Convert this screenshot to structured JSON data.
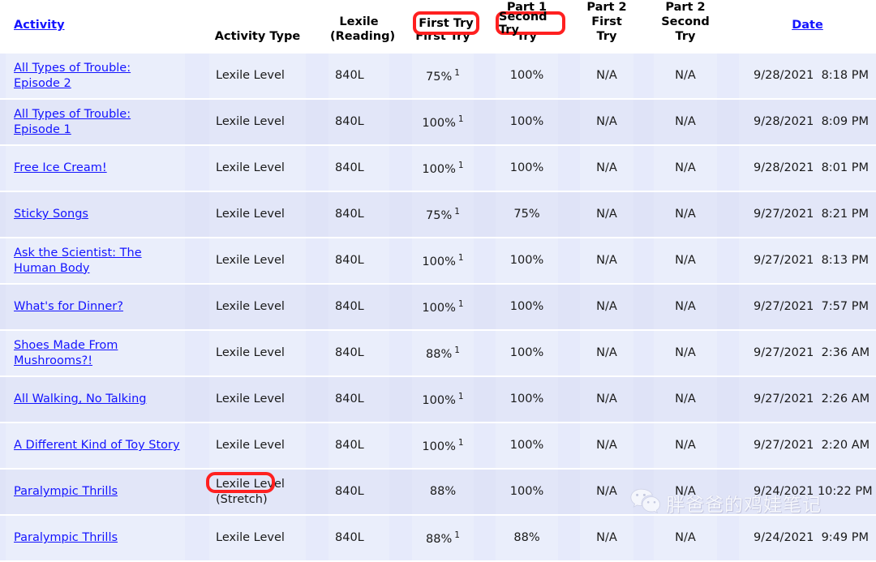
{
  "table": {
    "columns": [
      {
        "key": "activity",
        "label": "Activity",
        "link": true,
        "align": "left"
      },
      {
        "key": "type",
        "label": "Activity Type",
        "link": false,
        "align": "center"
      },
      {
        "key": "lexile",
        "label": "Lexile\n(Reading)",
        "link": false,
        "align": "center"
      },
      {
        "key": "p1first",
        "label": "Part 1\nFirst Try",
        "link": false,
        "align": "center"
      },
      {
        "key": "p1second",
        "label": "Part 1\nSecond Try",
        "link": false,
        "align": "center"
      },
      {
        "key": "p2first",
        "label": "Part 2\nFirst\nTry",
        "link": false,
        "align": "center"
      },
      {
        "key": "p2second",
        "label": "Part 2\nSecond\nTry",
        "link": false,
        "align": "center"
      },
      {
        "key": "date",
        "label": "Date",
        "link": true,
        "align": "center"
      }
    ],
    "headers": {
      "activity": "Activity",
      "activity_type": "Activity Type",
      "lexile_line1": "Lexile",
      "lexile_line2": "(Reading)",
      "part1_line1": "Part 1",
      "part1_first_try": "First Try",
      "part1b_line1": "Part 1",
      "part1_second_try": "Second Try",
      "part2_first": "Part 2\nFirst\nTry",
      "part2_second": "Part 2\nSecond\nTry",
      "date": "Date"
    },
    "rows": [
      {
        "activity": "All Types of Trouble: Episode 2",
        "type": "Lexile Level",
        "type_note": "",
        "lexile": "840L",
        "p1_first": "75%",
        "p1_first_footnote": "1",
        "p1_second": "100%",
        "p2_first": "N/A",
        "p2_second": "N/A",
        "date": "9/28/2021  8:18 PM"
      },
      {
        "activity": "All Types of Trouble: Episode 1",
        "type": "Lexile Level",
        "type_note": "",
        "lexile": "840L",
        "p1_first": "100%",
        "p1_first_footnote": "1",
        "p1_second": "100%",
        "p2_first": "N/A",
        "p2_second": "N/A",
        "date": "9/28/2021  8:09 PM"
      },
      {
        "activity": "Free Ice Cream!",
        "type": "Lexile Level",
        "type_note": "",
        "lexile": "840L",
        "p1_first": "100%",
        "p1_first_footnote": "1",
        "p1_second": "100%",
        "p2_first": "N/A",
        "p2_second": "N/A",
        "date": "9/28/2021  8:01 PM"
      },
      {
        "activity": "Sticky Songs",
        "type": "Lexile Level",
        "type_note": "",
        "lexile": "840L",
        "p1_first": "75%",
        "p1_first_footnote": "1",
        "p1_second": "75%",
        "p2_first": "N/A",
        "p2_second": "N/A",
        "date": "9/27/2021  8:21 PM"
      },
      {
        "activity": "Ask the Scientist: The Human Body",
        "type": "Lexile Level",
        "type_note": "",
        "lexile": "840L",
        "p1_first": "100%",
        "p1_first_footnote": "1",
        "p1_second": "100%",
        "p2_first": "N/A",
        "p2_second": "N/A",
        "date": "9/27/2021  8:13 PM"
      },
      {
        "activity": "What's for Dinner?",
        "type": "Lexile Level",
        "type_note": "",
        "lexile": "840L",
        "p1_first": "100%",
        "p1_first_footnote": "1",
        "p1_second": "100%",
        "p2_first": "N/A",
        "p2_second": "N/A",
        "date": "9/27/2021  7:57 PM"
      },
      {
        "activity": "Shoes Made From Mushrooms?!",
        "type": "Lexile Level",
        "type_note": "",
        "lexile": "840L",
        "p1_first": "88%",
        "p1_first_footnote": "1",
        "p1_second": "100%",
        "p2_first": "N/A",
        "p2_second": "N/A",
        "date": "9/27/2021  2:36 AM"
      },
      {
        "activity": "All Walking, No Talking",
        "type": "Lexile Level",
        "type_note": "",
        "lexile": "840L",
        "p1_first": "100%",
        "p1_first_footnote": "1",
        "p1_second": "100%",
        "p2_first": "N/A",
        "p2_second": "N/A",
        "date": "9/27/2021  2:26 AM"
      },
      {
        "activity": "A Different Kind of Toy Story",
        "type": "Lexile Level",
        "type_note": "",
        "lexile": "840L",
        "p1_first": "100%",
        "p1_first_footnote": "1",
        "p1_second": "100%",
        "p2_first": "N/A",
        "p2_second": "N/A",
        "date": "9/27/2021  2:20 AM"
      },
      {
        "activity": "Paralympic Thrills",
        "type": "Lexile Level",
        "type_note": "(Stretch)",
        "lexile": "840L",
        "p1_first": "88%",
        "p1_first_footnote": "",
        "p1_second": "100%",
        "p2_first": "N/A",
        "p2_second": "N/A",
        "date": "9/24/2021 10:22 PM"
      },
      {
        "activity": "Paralympic Thrills",
        "type": "Lexile Level",
        "type_note": "",
        "lexile": "840L",
        "p1_first": "88%",
        "p1_first_footnote": "1",
        "p1_second": "88%",
        "p2_first": "N/A",
        "p2_second": "N/A",
        "date": "9/24/2021  9:49 PM"
      }
    ]
  },
  "annotations": {
    "color": "#ff2020",
    "first_try_box": "First Try",
    "second_try_box": "Second Try",
    "stretch_circle": "(Stretch)"
  },
  "watermark": {
    "text": "胖爸爸的鸡娃笔记",
    "logo": "wechat-logo"
  },
  "colors": {
    "link": "#1414ff",
    "row_light": "#eaeefb",
    "row_dark": "#e2e6f8",
    "annotation_red": "#ff2020"
  }
}
